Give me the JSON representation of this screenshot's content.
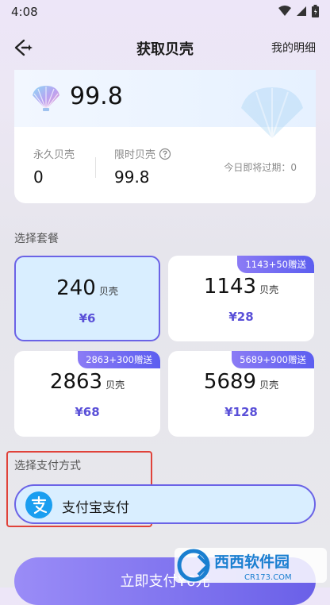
{
  "status": {
    "time": "4:08"
  },
  "nav": {
    "title": "获取贝壳",
    "right_link": "我的明细"
  },
  "balance": {
    "value": "99.8",
    "permanent_label": "永久贝壳",
    "permanent_value": "0",
    "limited_label": "限时贝壳",
    "limited_value": "99.8",
    "expiring_label": "今日即将过期：",
    "expiring_value": "0"
  },
  "packages": {
    "section_label": "选择套餐",
    "unit": "贝壳",
    "items": [
      {
        "amount": "240",
        "price": "¥6",
        "badge": "",
        "selected": true
      },
      {
        "amount": "1143",
        "price": "¥28",
        "badge": "1143+50赠送",
        "selected": false
      },
      {
        "amount": "2863",
        "price": "¥68",
        "badge": "2863+300赠送",
        "selected": false
      },
      {
        "amount": "5689",
        "price": "¥128",
        "badge": "5689+900赠送",
        "selected": false
      }
    ]
  },
  "payment": {
    "section_label": "选择支付方式",
    "method_label": "支付宝支付",
    "icon_glyph": "支"
  },
  "confirm": {
    "label": "立即支付¥6元"
  },
  "watermark": {
    "text_top": "西西软件园",
    "text_bottom": "CR173.COM"
  },
  "colors": {
    "accent": "#6b63e6",
    "selected_bg": "#d9eeff",
    "price": "#5a50d8",
    "alipay": "#1a9ef0",
    "highlight": "#e0423a"
  }
}
